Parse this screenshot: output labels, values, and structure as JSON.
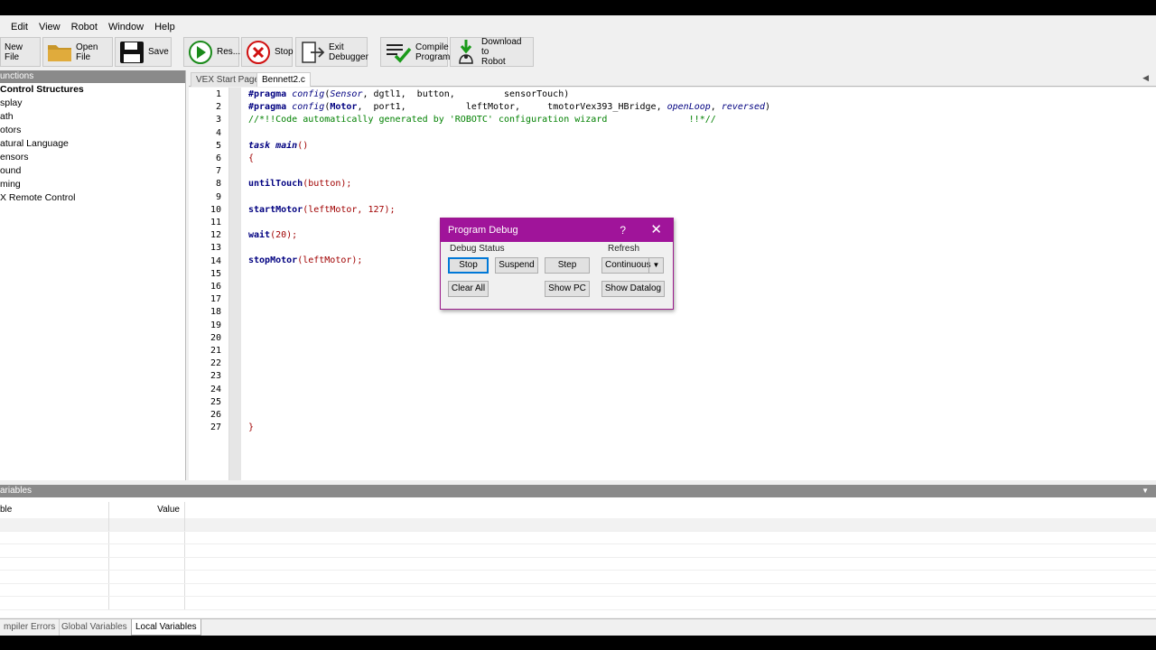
{
  "menu": [
    "Edit",
    "View",
    "Robot",
    "Window",
    "Help"
  ],
  "toolbar": {
    "new_file": "New File",
    "open_file": "Open File",
    "save": "Save",
    "resume": "Res...",
    "stop": "Stop",
    "exit_debugger": "Exit\nDebugger",
    "compile": "Compile\nProgram",
    "download": "Download to\nRobot"
  },
  "functions_panel": {
    "title": "unctions",
    "items": [
      "Control Structures",
      "splay",
      "ath",
      "otors",
      "atural Language",
      "ensors",
      "ound",
      "ming",
      "X Remote Control"
    ]
  },
  "editor": {
    "tabs": [
      "VEX Start Page",
      "Bennett2.c"
    ],
    "active_tab": "Bennett2.c",
    "line_numbers": [
      "1",
      "2",
      "3",
      "4",
      "5",
      "6",
      "7",
      "8",
      "9",
      "10",
      "11",
      "12",
      "13",
      "14",
      "15",
      "16",
      "17",
      "18",
      "19",
      "20",
      "21",
      "22",
      "23",
      "24",
      "25",
      "26",
      "27"
    ]
  },
  "variables_panel": {
    "title": "ariables",
    "col_name": "ble",
    "col_value": "Value"
  },
  "bottom_tabs": [
    "mpiler Errors",
    "Global Variables",
    "Local Variables"
  ],
  "dialog": {
    "title": "Program Debug",
    "help": "?",
    "close": "✕",
    "debug_status_label": "Debug Status",
    "refresh_label": "Refresh",
    "stop": "Stop",
    "suspend": "Suspend",
    "step": "Step",
    "refresh_value": "Continuous",
    "clear_all": "Clear All",
    "show_pc": "Show PC",
    "show_datalog": "Show Datalog"
  },
  "colors": {
    "dialog_title": "#a0149a",
    "panel_header": "#8a8a8a",
    "keyword": "#000080",
    "comment": "#008000"
  }
}
